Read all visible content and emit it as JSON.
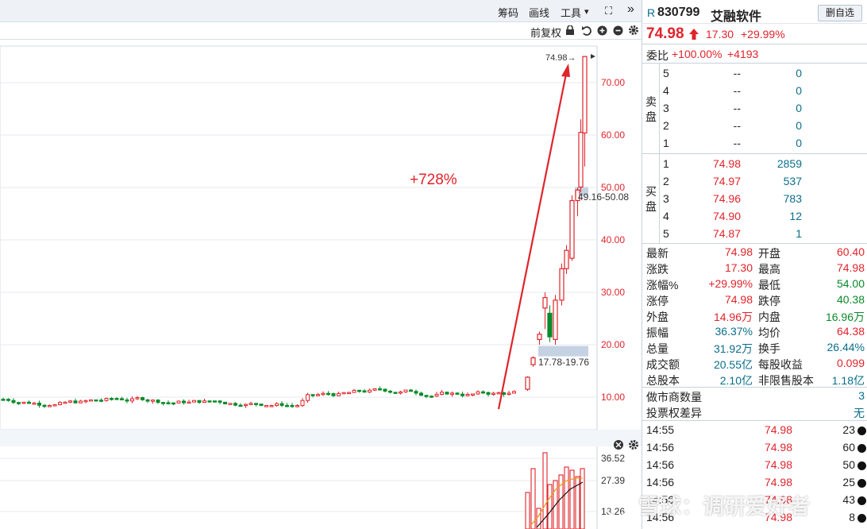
{
  "toolbar": {
    "chips_label": "筹码",
    "draw_label": "画线",
    "tools_label": "工具",
    "tools_arrow": "▾",
    "fullscreen_glyph": "⛶",
    "more_glyph": "»",
    "adjust_label": "前复权"
  },
  "chart": {
    "annotation_gain": "+728%",
    "price_marker": "74.98→",
    "range_upper": "49.16-50.08",
    "range_lower": "17.78-19.76",
    "y_ticks": [
      "70.00",
      "60.00",
      "50.00",
      "40.00",
      "30.00",
      "20.00",
      "10.00"
    ],
    "volume_ticks": [
      "36.52",
      "27.39",
      "18.26"
    ],
    "watermark": "雪球：调研爱好者"
  },
  "chart_data": {
    "type": "candlestick",
    "y_range": [
      2,
      77
    ],
    "recent_candles": [
      {
        "o": 11.5,
        "h": 14.0,
        "l": 11.2,
        "c": 13.8
      },
      {
        "o": 16.2,
        "h": 17.8,
        "l": 15.8,
        "c": 17.5
      },
      {
        "o": 21.0,
        "h": 22.5,
        "l": 20.0,
        "c": 22.0
      },
      {
        "o": 27.0,
        "h": 30.0,
        "l": 23.0,
        "c": 29.0
      },
      {
        "o": 26.0,
        "h": 27.5,
        "l": 20.5,
        "c": 21.5
      },
      {
        "o": 21.0,
        "h": 29.5,
        "l": 20.0,
        "c": 28.5
      },
      {
        "o": 28.5,
        "h": 35.5,
        "l": 27.5,
        "c": 34.5
      },
      {
        "o": 34.5,
        "h": 39.0,
        "l": 33.5,
        "c": 38.0
      },
      {
        "o": 36.5,
        "h": 48.5,
        "l": 36.0,
        "c": 47.5
      },
      {
        "o": 47.5,
        "h": 50.0,
        "l": 44.5,
        "c": 49.5
      },
      {
        "o": 50.08,
        "h": 63.0,
        "l": 49.16,
        "c": 60.5
      },
      {
        "o": 60.4,
        "h": 74.98,
        "l": 54.0,
        "c": 74.98
      }
    ]
  },
  "stock": {
    "market_tag": "R",
    "code": "830799",
    "name": "艾融软件",
    "delete_watch_label": "删自选",
    "price": "74.98",
    "change": "17.30",
    "change_pct": "+29.99%",
    "ratio_label": "委比",
    "ratio_pct": "+100.00%",
    "ratio_diff": "+4193"
  },
  "sell": {
    "side_label_1": "卖",
    "side_label_2": "盘",
    "levels": [
      {
        "lvl": "5",
        "price": "--",
        "vol": "0"
      },
      {
        "lvl": "4",
        "price": "--",
        "vol": "0"
      },
      {
        "lvl": "3",
        "price": "--",
        "vol": "0"
      },
      {
        "lvl": "2",
        "price": "--",
        "vol": "0"
      },
      {
        "lvl": "1",
        "price": "--",
        "vol": "0"
      }
    ]
  },
  "buy": {
    "side_label_1": "买",
    "side_label_2": "盘",
    "levels": [
      {
        "lvl": "1",
        "price": "74.98",
        "vol": "2859"
      },
      {
        "lvl": "2",
        "price": "74.97",
        "vol": "537"
      },
      {
        "lvl": "3",
        "price": "74.96",
        "vol": "783"
      },
      {
        "lvl": "4",
        "price": "74.90",
        "vol": "12"
      },
      {
        "lvl": "5",
        "price": "74.87",
        "vol": "1"
      }
    ]
  },
  "stats": [
    {
      "l1": "最新",
      "v1": "74.98",
      "l2": "开盘",
      "v2": "60.40"
    },
    {
      "l1": "涨跌",
      "v1": "17.30",
      "l2": "最高",
      "v2": "74.98"
    },
    {
      "l1": "涨幅%",
      "v1": "+29.99%",
      "l2": "最低",
      "v2": "54.00"
    },
    {
      "l1": "涨停",
      "v1": "74.98",
      "l2": "跌停",
      "v2": "40.38"
    },
    {
      "l1": "外盘",
      "v1": "14.96万",
      "l2": "内盘",
      "v2": "16.96万"
    },
    {
      "l1": "振幅",
      "v1": "36.37%",
      "l2": "均价",
      "v2": "64.38"
    },
    {
      "l1": "总量",
      "v1": "31.92万",
      "l2": "换手",
      "v2": "26.44%"
    },
    {
      "l1": "成交额",
      "v1": "20.55亿",
      "l2": "每股收益",
      "v2": "0.099"
    },
    {
      "l1": "总股本",
      "v1": "2.10亿",
      "l2": "非限售股本",
      "v2": "1.18亿"
    }
  ],
  "extra": [
    {
      "label": "做市商数量",
      "value": "3"
    },
    {
      "label": "投票权差异",
      "value": "无"
    }
  ],
  "ticks": [
    {
      "time": "14:55",
      "price": "74.98",
      "vol": "23"
    },
    {
      "time": "14:56",
      "price": "74.98",
      "vol": "60"
    },
    {
      "time": "14:56",
      "price": "74.98",
      "vol": "50"
    },
    {
      "time": "14:56",
      "price": "74.98",
      "vol": "25"
    },
    {
      "time": "14:56",
      "price": "74.98",
      "vol": "43"
    },
    {
      "time": "14:56",
      "price": "74.98",
      "vol": "8"
    }
  ],
  "colors": {
    "up": "#e0242b",
    "down": "#0a8a2a",
    "accent": "#0a6e8a"
  }
}
